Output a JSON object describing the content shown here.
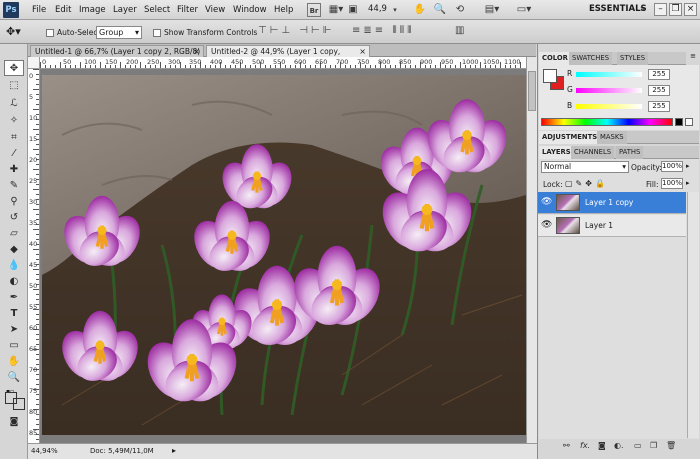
{
  "app": {
    "logo": "Ps"
  },
  "menu": [
    "File",
    "Edit",
    "Image",
    "Layer",
    "Select",
    "Filter",
    "View",
    "Window",
    "Help"
  ],
  "toolbar": {
    "bridge_label": "Br",
    "zoom_level": "44,9",
    "workspace": "ESSENTIALS",
    "icons": [
      "minibridge-icon",
      "arrange-icon",
      "zoom-dropdown-icon",
      "hand-icon",
      "zoom-icon",
      "rotate-icon",
      "screen-mode-icon",
      "arrange-docs-icon"
    ]
  },
  "options": {
    "auto_select_label": "Auto-Select:",
    "auto_select_value": "Group",
    "transform_label": "Show Transform Controls"
  },
  "tabs": [
    {
      "label": "Untitled-1 @ 66,7% (Layer 1 copy 2, RGB/8) *",
      "close": "×"
    },
    {
      "label": "Untitled-2 @ 44,9% (Layer 1 copy, RGB/8) *",
      "close": "×"
    }
  ],
  "ruler_top": [
    "0",
    "50",
    "100",
    "150",
    "200",
    "250",
    "300",
    "350",
    "400",
    "450",
    "500",
    "550",
    "600",
    "650",
    "700",
    "750",
    "800",
    "850",
    "900",
    "950",
    "1000",
    "1050",
    "1100"
  ],
  "ruler_left": [
    "0",
    "5",
    "10",
    "15",
    "20",
    "25",
    "30",
    "35",
    "40",
    "45",
    "50",
    "55",
    "60",
    "65",
    "70",
    "75",
    "80",
    "85"
  ],
  "status": {
    "zoom": "44,94%",
    "doc": "Doc: 5,49M/11,0M"
  },
  "color_panel": {
    "tabs": [
      "COLOR",
      "SWATCHES",
      "STYLES"
    ],
    "r_label": "R",
    "g_label": "G",
    "b_label": "B",
    "r": "255",
    "g": "255",
    "b": "255"
  },
  "adjust_tabs": [
    "ADJUSTMENTS",
    "MASKS"
  ],
  "layers_panel": {
    "tabs": [
      "LAYERS",
      "CHANNELS",
      "PATHS"
    ],
    "blend_mode": "Normal",
    "opacity_label": "Opacity:",
    "opacity": "100%",
    "lock_label": "Lock:",
    "fill_label": "Fill:",
    "fill": "100%",
    "layers": [
      {
        "name": "Layer 1 copy",
        "selected": true
      },
      {
        "name": "Layer 1",
        "selected": false
      }
    ]
  },
  "colors": {
    "selection": "#3a7fd7",
    "foreground": "#ffffff",
    "background": "#e02020"
  }
}
